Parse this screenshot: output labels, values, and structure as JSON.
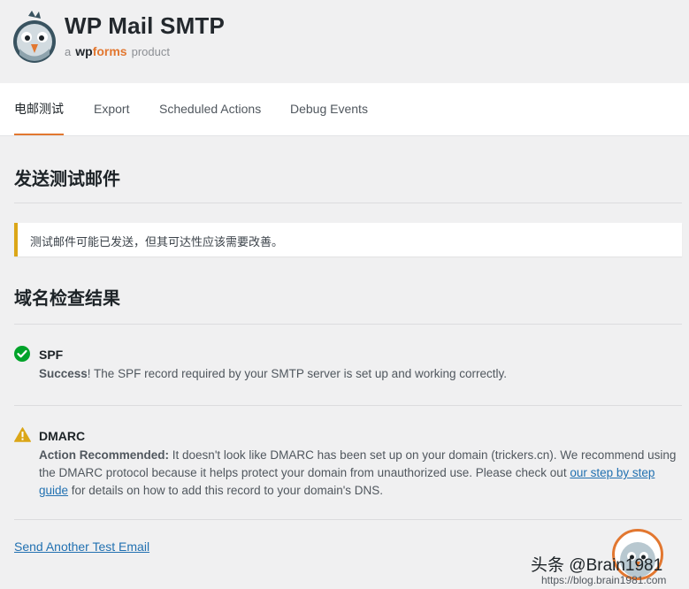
{
  "brand": {
    "title": "WP Mail SMTP",
    "sub_prefix": "a",
    "sub_wp": "wp",
    "sub_forms": "forms",
    "sub_suffix": "product"
  },
  "tabs": [
    {
      "label": "电邮测试",
      "active": true
    },
    {
      "label": "Export",
      "active": false
    },
    {
      "label": "Scheduled Actions",
      "active": false
    },
    {
      "label": "Debug Events",
      "active": false
    }
  ],
  "section1": {
    "title": "发送测试邮件"
  },
  "notice": {
    "text": "测试邮件可能已发送，但其可达性应该需要改善。"
  },
  "section2": {
    "title": "域名检查结果"
  },
  "checks": {
    "spf": {
      "title": "SPF",
      "status_label": "Success",
      "message": "! The SPF record required by your SMTP server is set up and working correctly."
    },
    "dmarc": {
      "title": "DMARC",
      "status_label": "Action Recommended:",
      "message_1": " It doesn't look like DMARC has been set up on your domain (trickers.cn). We recommend using the DMARC protocol because it helps protect your domain from unauthorized use. Please check out ",
      "link_text": "our step by step guide",
      "message_2": " for details on how to add this record to your domain's DNS."
    }
  },
  "send_another": "Send Another Test Email",
  "watermark": {
    "line1": "头条 @Brain1981",
    "line2": "https://blog.brain1981.com"
  },
  "colors": {
    "accent": "#e27730",
    "success": "#00a32a",
    "warning": "#dba617",
    "link": "#2271b1"
  }
}
